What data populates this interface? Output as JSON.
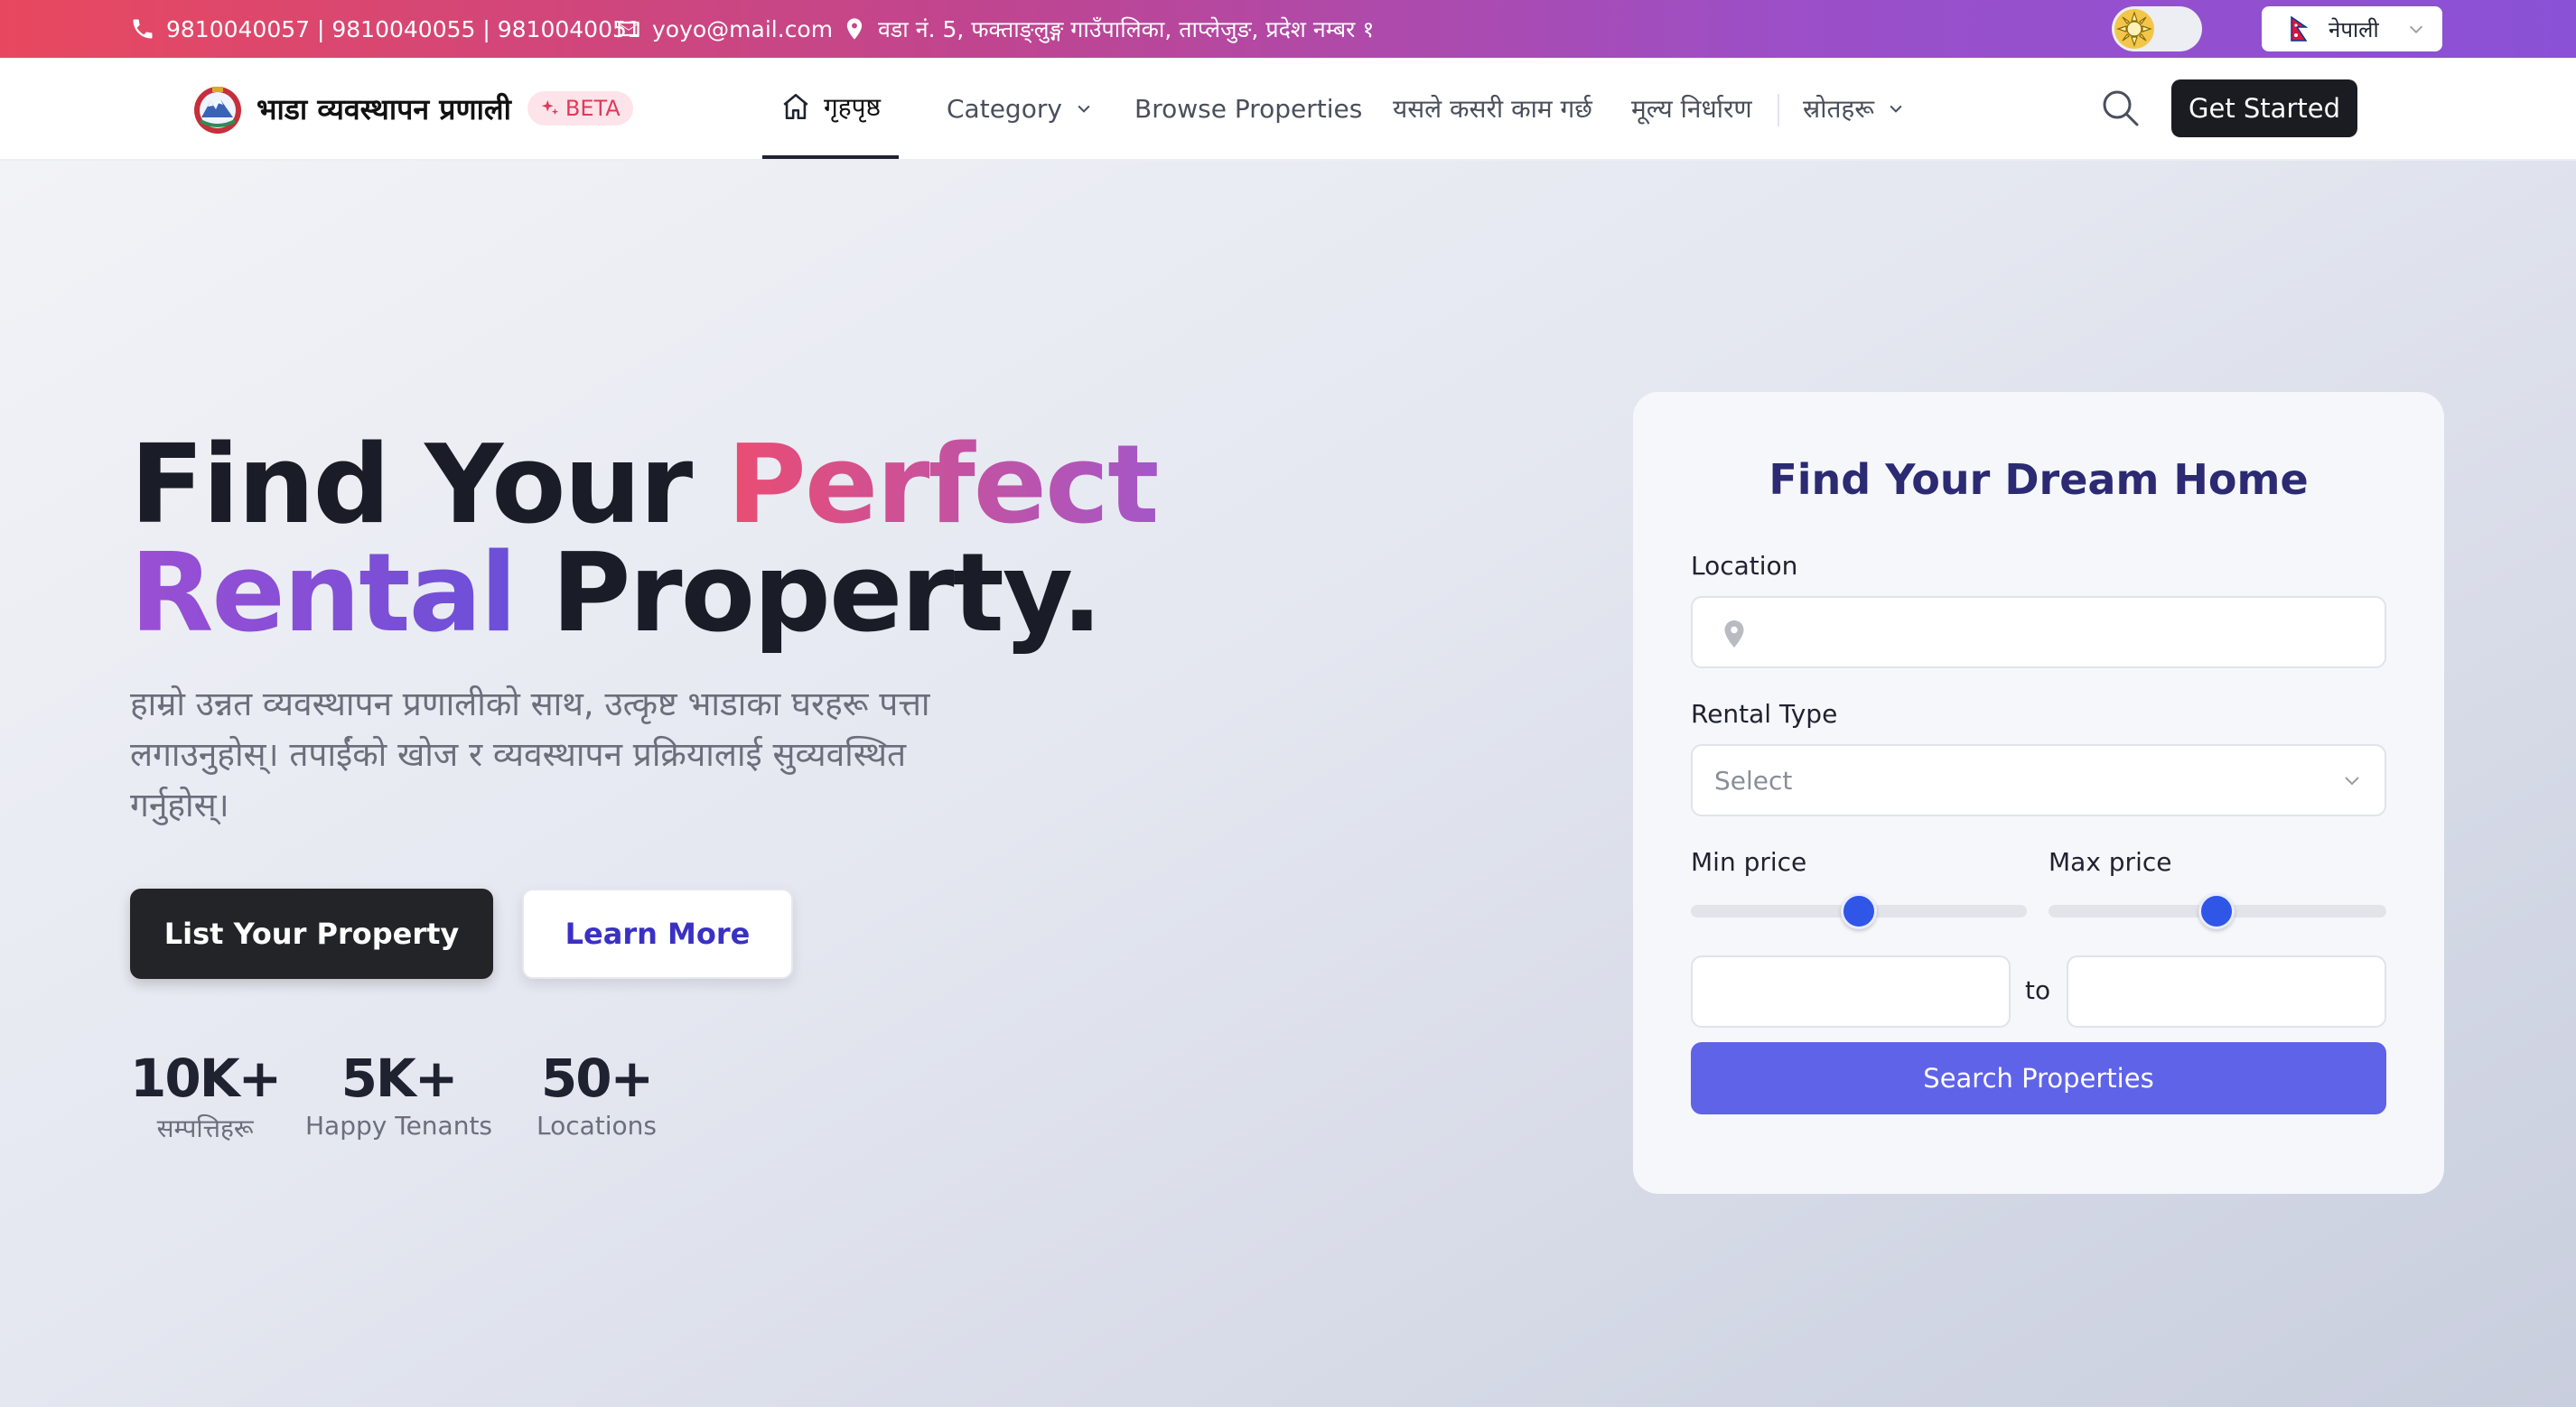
{
  "contact_bar": {
    "phones": "9810040057 | 9810040055 | 9810040051",
    "email": "yoyo@mail.com",
    "address": "वडा नं. 5, फक्ताङ्लुङ्ग गाउँपालिका, ताप्लेजुङ, प्रदेश नम्बर १",
    "language": "नेपाली",
    "icons": [
      "phone-icon",
      "mail-icon",
      "location-pin-icon",
      "sun-icon",
      "nepal-flag-icon",
      "chevron-down-icon"
    ]
  },
  "navbar": {
    "brand": "भाडा व्यवस्थापन प्रणाली",
    "badge": "BETA",
    "items": [
      {
        "label": "गृहपृष्ठ",
        "active": true
      },
      {
        "label": "Category"
      },
      {
        "label": "Browse Properties"
      },
      {
        "label": "यसले कसरी काम गर्छ"
      },
      {
        "label": "मूल्य निर्धारण"
      },
      {
        "label": "स्रोतहरू"
      }
    ],
    "cta": "Get Started"
  },
  "hero": {
    "headline": {
      "part1": "Find Your ",
      "part2": "Perfect",
      "part3": "Rental",
      "part4": " Property."
    },
    "subtext": "हाम्रो उन्नत व्यवस्थापन प्रणालीको साथ, उत्कृष्ट भाडाका घरहरू पत्ता लगाउनुहोस्। तपाईंको खोज र व्यवस्थापन प्रक्रियालाई सुव्यवस्थित गर्नुहोस्।",
    "primary_button": "List Your Property",
    "secondary_button": "Learn More",
    "stats": [
      {
        "value": "10K+",
        "label": "सम्पत्तिहरू"
      },
      {
        "value": "5K+",
        "label": "Happy Tenants"
      },
      {
        "value": "50+",
        "label": "Locations"
      }
    ]
  },
  "search_card": {
    "title": "Find Your Dream Home",
    "location_label": "Location",
    "location_value": "",
    "rental_type_label": "Rental Type",
    "rental_type_value": "Select",
    "min_price_label": "Min price",
    "max_price_label": "Max price",
    "min_price_value": "",
    "max_price_value": "",
    "range_separator": "to",
    "submit": "Search Properties"
  },
  "colors": {
    "accent_pink": "#ea4d72",
    "accent_purple": "#8a51d6",
    "primary_button": "#5f63e8",
    "title_navy": "#2b2a72",
    "slider_thumb": "#2f56e6"
  }
}
